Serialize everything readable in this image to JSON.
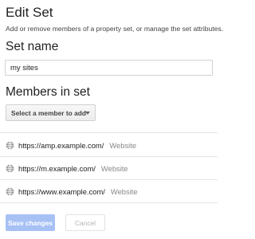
{
  "dialog": {
    "title": "Edit Set",
    "description": "Add or remove members of a property set, or manage the set attributes."
  },
  "set_name": {
    "label": "Set name",
    "value": "my sites"
  },
  "members": {
    "label": "Members in set",
    "add_select_label": "Select a member to add",
    "items": [
      {
        "icon": "globe-icon",
        "url": "https://amp.example.com/",
        "type": "Website"
      },
      {
        "icon": "globe-icon",
        "url": "https://m.example.com/",
        "type": "Website"
      },
      {
        "icon": "globe-icon",
        "url": "https://www.example.com/",
        "type": "Website"
      }
    ]
  },
  "actions": {
    "save_label": "Save changes",
    "cancel_label": "Cancel"
  },
  "colors": {
    "save_button_disabled": "#a7c1f5",
    "globe_icon": "#8a8a8a",
    "divider": "#e5e5e5"
  }
}
